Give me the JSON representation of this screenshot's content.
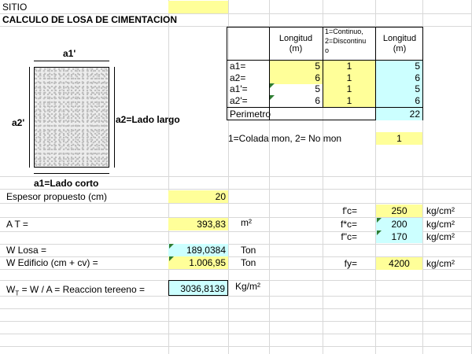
{
  "site": {
    "label": "SITIO"
  },
  "title": "CALCULO DE LOSA DE CIMENTACION",
  "diagram": {
    "top_label": "a1'",
    "left_label": "a2'",
    "right_label": "a2=Lado largo",
    "bottom_label": "a1=Lado corto"
  },
  "dims_table": {
    "header_longitud": "Longitud\n(m)",
    "header_type": "1=Continuo,\n2=Discontinu\no",
    "header_longitud2": "Longitud\n(m)",
    "rows": [
      {
        "name": "a1=",
        "length": "5",
        "type": "1",
        "result": "5"
      },
      {
        "name": "a2=",
        "length": "6",
        "type": "1",
        "result": "6"
      },
      {
        "name": "a1'=",
        "length": "5",
        "type": "1",
        "result": "5"
      },
      {
        "name": "a2'=",
        "length": "6",
        "type": "1",
        "result": "6"
      }
    ],
    "perimeter_label": "Perimetro",
    "perimeter_value": "22"
  },
  "colada": {
    "label": "1=Colada mon, 2= No mon",
    "value": "1"
  },
  "inputs": {
    "espesor": {
      "label": "Espesor propuesto (cm)",
      "value": "20"
    },
    "at": {
      "label": "A T =",
      "value": "393,83",
      "unit": "m²"
    },
    "wlosa": {
      "label": "W Losa =",
      "value": "189,0384",
      "unit": "Ton"
    },
    "wedificio": {
      "label": "W Edificio (cm + cv) =",
      "value": "1.006,95",
      "unit": "Ton"
    },
    "wt": {
      "label_w": "W",
      "label_sub": "T",
      "label_rest": "= W / A = Reaccion tereeno =",
      "value": "3036,8139",
      "unit": "Kg/m²"
    }
  },
  "materials": [
    {
      "label": "f'c=",
      "value": "250",
      "unit": "kg/cm²",
      "color": "yellow"
    },
    {
      "label": "f*c=",
      "value": "200",
      "unit": "kg/cm²",
      "color": "cyan"
    },
    {
      "label": "f\"c=",
      "value": "170",
      "unit": "kg/cm²",
      "color": "cyan"
    },
    {
      "label": "fy=",
      "value": "4200",
      "unit": "kg/cm²",
      "color": "yellow"
    }
  ],
  "colors": {
    "yellow": "#ffff99",
    "cyan": "#ccffff",
    "grid": "#d8d8d8",
    "marker": "#2e7d32"
  }
}
